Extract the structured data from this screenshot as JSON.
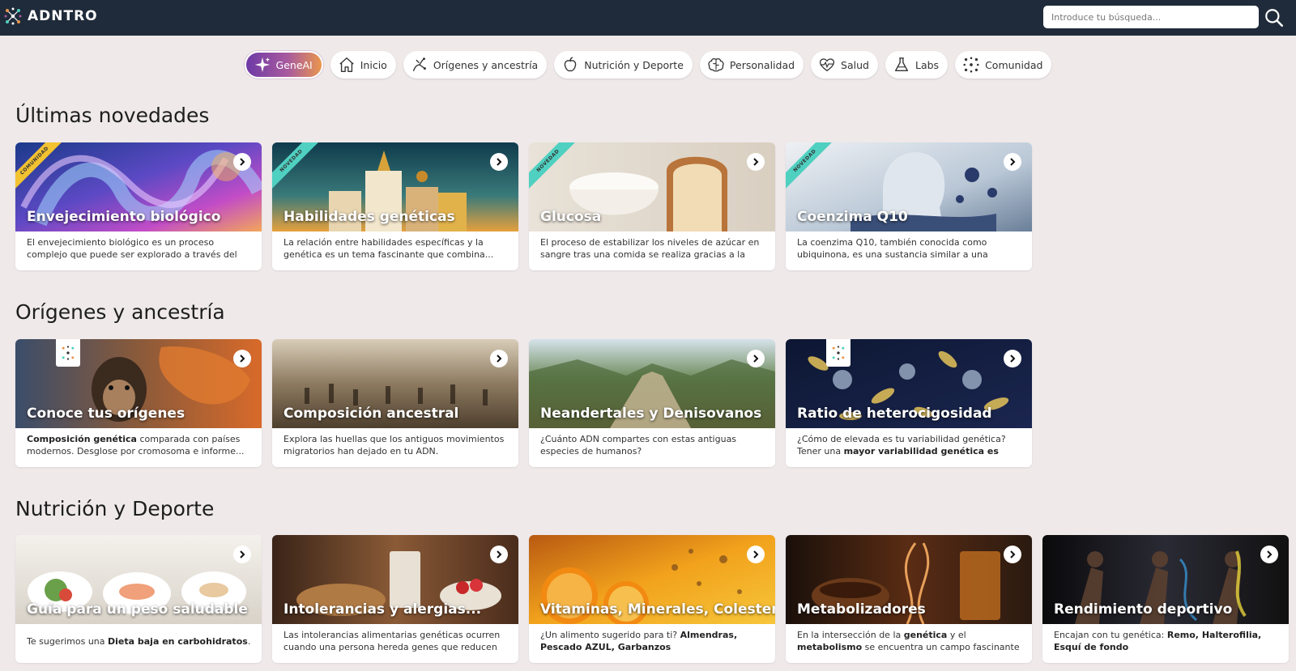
{
  "brand": {
    "name": "ADNTRO"
  },
  "search": {
    "placeholder": "Introduce tu búsqueda..."
  },
  "nav": [
    {
      "label": "GeneAI",
      "icon": "sparkle-icon",
      "active": true
    },
    {
      "label": "Inicio",
      "icon": "home-icon"
    },
    {
      "label": "Orígenes y ancestría",
      "icon": "ancestry-icon"
    },
    {
      "label": "Nutrición y Deporte",
      "icon": "apple-icon"
    },
    {
      "label": "Personalidad",
      "icon": "brain-icon"
    },
    {
      "label": "Salud",
      "icon": "heartbeat-icon"
    },
    {
      "label": "Labs",
      "icon": "flask-icon"
    },
    {
      "label": "Comunidad",
      "icon": "community-icon"
    }
  ],
  "sections": [
    {
      "title": "Últimas novedades",
      "cards": [
        {
          "title": "Envejecimiento biológico",
          "ribbon": "COMUNIDAD",
          "desc": "El envejecimiento biológico es un proceso complejo que puede ser explorado a través del análisis del..."
        },
        {
          "title": "Habilidades genéticas",
          "ribbon": "NOVEDAD",
          "desc": "La relación entre habilidades específicas y la genética es un tema fascinante que combina..."
        },
        {
          "title": "Glucosa",
          "ribbon": "NOVEDAD",
          "desc": "El proceso de estabilizar los niveles de azúcar en sangre tras una comida se realiza gracias a la acció..."
        },
        {
          "title": "Coenzima Q10",
          "ribbon": "NOVEDAD",
          "desc": "La coenzima Q10, también conocida como ubiquinona, es una sustancia similar a una vitamina..."
        }
      ]
    },
    {
      "title": "Orígenes y ancestría",
      "cards": [
        {
          "title": "Conoce tus orígenes",
          "badge": true,
          "desc_b": "Composición genética",
          "desc": " comparada con países modernos. Desglose por cromosoma e informe..."
        },
        {
          "title": "Composición ancestral",
          "desc": "Explora las huellas que los antiguos movimientos migratorios han dejado en tu ADN."
        },
        {
          "title": "Neandertales y Denisovanos",
          "desc": "¿Cuánto ADN compartes con estas antiguas especies de humanos?"
        },
        {
          "title": "Ratio de heterocigosidad",
          "badge": true,
          "desc": "¿Cómo de elevada es tu variabilidad genética? Tener una ",
          "desc_b2": "mayor variabilidad genética es protectora",
          "desc_end": "..."
        }
      ]
    },
    {
      "title": "Nutrición y Deporte",
      "cards": [
        {
          "title": "Guía para un peso saludable",
          "desc": "Te sugerimos una ",
          "desc_b2": "Dieta baja en carbohidratos",
          "desc_end": "."
        },
        {
          "title": "Intolerancias y alergias...",
          "desc": "Las intolerancias alimentarias genéticas ocurren cuando una persona hereda genes que reducen la..."
        },
        {
          "title": "Vitaminas, Minerales, Colesterol",
          "desc": "¿Un alimento sugerido para ti? ",
          "desc_b2": "Almendras, Pescado AZUL, Garbanzos",
          "desc_end": ""
        },
        {
          "title": "Metabolizadores",
          "desc": "En la intersección de la ",
          "desc_b2": "genética",
          "desc_mid": " y el ",
          "desc_b3": "metabolismo",
          "desc_end": " se encuentra un campo fascinante de estudio que..."
        },
        {
          "title": "Rendimiento deportivo",
          "desc": "Encajan con tu genética: ",
          "desc_b2": "Remo, Halterofilia, Esquí de fondo",
          "desc_end": ""
        }
      ]
    }
  ]
}
